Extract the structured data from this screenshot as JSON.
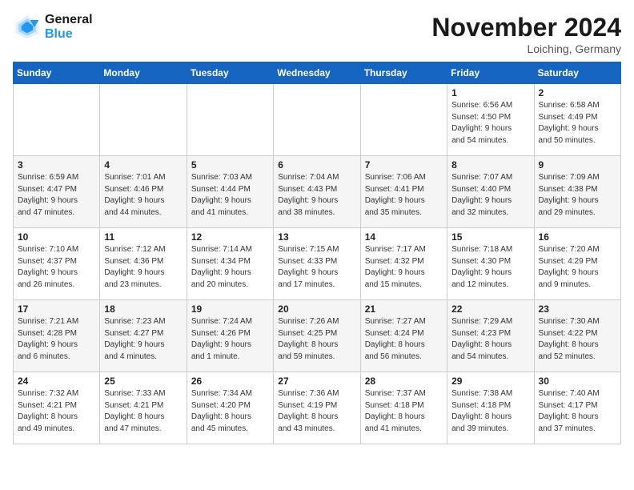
{
  "header": {
    "logo_general": "General",
    "logo_blue": "Blue",
    "month_title": "November 2024",
    "location": "Loiching, Germany"
  },
  "days_of_week": [
    "Sunday",
    "Monday",
    "Tuesday",
    "Wednesday",
    "Thursday",
    "Friday",
    "Saturday"
  ],
  "weeks": [
    [
      {
        "day": "",
        "info": ""
      },
      {
        "day": "",
        "info": ""
      },
      {
        "day": "",
        "info": ""
      },
      {
        "day": "",
        "info": ""
      },
      {
        "day": "",
        "info": ""
      },
      {
        "day": "1",
        "info": "Sunrise: 6:56 AM\nSunset: 4:50 PM\nDaylight: 9 hours\nand 54 minutes."
      },
      {
        "day": "2",
        "info": "Sunrise: 6:58 AM\nSunset: 4:49 PM\nDaylight: 9 hours\nand 50 minutes."
      }
    ],
    [
      {
        "day": "3",
        "info": "Sunrise: 6:59 AM\nSunset: 4:47 PM\nDaylight: 9 hours\nand 47 minutes."
      },
      {
        "day": "4",
        "info": "Sunrise: 7:01 AM\nSunset: 4:46 PM\nDaylight: 9 hours\nand 44 minutes."
      },
      {
        "day": "5",
        "info": "Sunrise: 7:03 AM\nSunset: 4:44 PM\nDaylight: 9 hours\nand 41 minutes."
      },
      {
        "day": "6",
        "info": "Sunrise: 7:04 AM\nSunset: 4:43 PM\nDaylight: 9 hours\nand 38 minutes."
      },
      {
        "day": "7",
        "info": "Sunrise: 7:06 AM\nSunset: 4:41 PM\nDaylight: 9 hours\nand 35 minutes."
      },
      {
        "day": "8",
        "info": "Sunrise: 7:07 AM\nSunset: 4:40 PM\nDaylight: 9 hours\nand 32 minutes."
      },
      {
        "day": "9",
        "info": "Sunrise: 7:09 AM\nSunset: 4:38 PM\nDaylight: 9 hours\nand 29 minutes."
      }
    ],
    [
      {
        "day": "10",
        "info": "Sunrise: 7:10 AM\nSunset: 4:37 PM\nDaylight: 9 hours\nand 26 minutes."
      },
      {
        "day": "11",
        "info": "Sunrise: 7:12 AM\nSunset: 4:36 PM\nDaylight: 9 hours\nand 23 minutes."
      },
      {
        "day": "12",
        "info": "Sunrise: 7:14 AM\nSunset: 4:34 PM\nDaylight: 9 hours\nand 20 minutes."
      },
      {
        "day": "13",
        "info": "Sunrise: 7:15 AM\nSunset: 4:33 PM\nDaylight: 9 hours\nand 17 minutes."
      },
      {
        "day": "14",
        "info": "Sunrise: 7:17 AM\nSunset: 4:32 PM\nDaylight: 9 hours\nand 15 minutes."
      },
      {
        "day": "15",
        "info": "Sunrise: 7:18 AM\nSunset: 4:30 PM\nDaylight: 9 hours\nand 12 minutes."
      },
      {
        "day": "16",
        "info": "Sunrise: 7:20 AM\nSunset: 4:29 PM\nDaylight: 9 hours\nand 9 minutes."
      }
    ],
    [
      {
        "day": "17",
        "info": "Sunrise: 7:21 AM\nSunset: 4:28 PM\nDaylight: 9 hours\nand 6 minutes."
      },
      {
        "day": "18",
        "info": "Sunrise: 7:23 AM\nSunset: 4:27 PM\nDaylight: 9 hours\nand 4 minutes."
      },
      {
        "day": "19",
        "info": "Sunrise: 7:24 AM\nSunset: 4:26 PM\nDaylight: 9 hours\nand 1 minute."
      },
      {
        "day": "20",
        "info": "Sunrise: 7:26 AM\nSunset: 4:25 PM\nDaylight: 8 hours\nand 59 minutes."
      },
      {
        "day": "21",
        "info": "Sunrise: 7:27 AM\nSunset: 4:24 PM\nDaylight: 8 hours\nand 56 minutes."
      },
      {
        "day": "22",
        "info": "Sunrise: 7:29 AM\nSunset: 4:23 PM\nDaylight: 8 hours\nand 54 minutes."
      },
      {
        "day": "23",
        "info": "Sunrise: 7:30 AM\nSunset: 4:22 PM\nDaylight: 8 hours\nand 52 minutes."
      }
    ],
    [
      {
        "day": "24",
        "info": "Sunrise: 7:32 AM\nSunset: 4:21 PM\nDaylight: 8 hours\nand 49 minutes."
      },
      {
        "day": "25",
        "info": "Sunrise: 7:33 AM\nSunset: 4:21 PM\nDaylight: 8 hours\nand 47 minutes."
      },
      {
        "day": "26",
        "info": "Sunrise: 7:34 AM\nSunset: 4:20 PM\nDaylight: 8 hours\nand 45 minutes."
      },
      {
        "day": "27",
        "info": "Sunrise: 7:36 AM\nSunset: 4:19 PM\nDaylight: 8 hours\nand 43 minutes."
      },
      {
        "day": "28",
        "info": "Sunrise: 7:37 AM\nSunset: 4:18 PM\nDaylight: 8 hours\nand 41 minutes."
      },
      {
        "day": "29",
        "info": "Sunrise: 7:38 AM\nSunset: 4:18 PM\nDaylight: 8 hours\nand 39 minutes."
      },
      {
        "day": "30",
        "info": "Sunrise: 7:40 AM\nSunset: 4:17 PM\nDaylight: 8 hours\nand 37 minutes."
      }
    ]
  ]
}
